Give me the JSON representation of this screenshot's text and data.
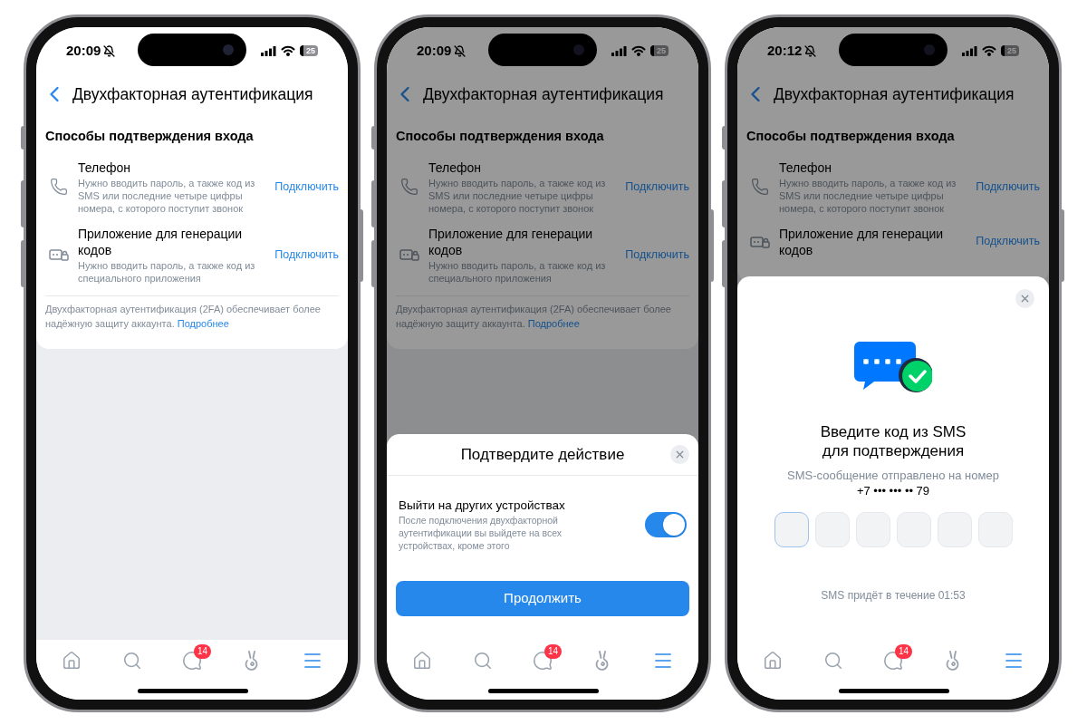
{
  "phones": [
    {
      "status": {
        "time": "20:09",
        "battery": "25"
      },
      "header": {
        "title": "Двухфакторная аутентификация"
      },
      "section_title": "Способы подтверждения входа",
      "methods": [
        {
          "kind": "phone",
          "title": "Телефон",
          "description": "Нужно вводить пароль, а также код из SMS или последние четыре цифры номера, с которого поступит звонок",
          "action": "Подключить"
        },
        {
          "kind": "app",
          "title": "Приложение для генерации кодов",
          "description": "Нужно вводить пароль, а также код из специального приложения",
          "action": "Подключить"
        }
      ],
      "footnote": {
        "text": "Двухфакторная аутентификация (2FA) обеспечивает более надёжную защиту аккаунта.",
        "link": "Подробнее"
      },
      "tabs": [
        {
          "kind": "home",
          "selected": false
        },
        {
          "kind": "search",
          "selected": false
        },
        {
          "kind": "messages",
          "selected": false,
          "badge": "14"
        },
        {
          "kind": "clips",
          "selected": false
        },
        {
          "kind": "menu",
          "selected": true
        }
      ]
    },
    {
      "status": {
        "time": "20:09",
        "battery": "25"
      },
      "header": {
        "title": "Двухфакторная аутентификация"
      },
      "section_title": "Способы подтверждения входа",
      "methods": [
        {
          "kind": "phone",
          "title": "Телефон",
          "description": "Нужно вводить пароль, а также код из SMS или последние четыре цифры номера, с которого поступит звонок",
          "action": "Подключить"
        },
        {
          "kind": "app",
          "title": "Приложение для генерации кодов",
          "description": "Нужно вводить пароль, а также код из специального приложения",
          "action": "Подключить"
        }
      ],
      "footnote": {
        "text": "Двухфакторная аутентификация (2FA) обеспечивает более надёжную защиту аккаунта.",
        "link": "Подробнее"
      },
      "tabs": [
        {
          "kind": "home",
          "selected": false
        },
        {
          "kind": "search",
          "selected": false
        },
        {
          "kind": "messages",
          "selected": false,
          "badge": "14"
        },
        {
          "kind": "clips",
          "selected": false
        },
        {
          "kind": "menu",
          "selected": true
        }
      ],
      "sheet": {
        "kind": "confirm",
        "title": "Подтвердите действие",
        "option": {
          "title": "Выйти на других устройствах",
          "description": "После подключения двухфакторной аутентификации вы выйдете на всех устройствах, кроме этого",
          "on": true
        },
        "button": "Продолжить"
      }
    },
    {
      "status": {
        "time": "20:12",
        "battery": "25"
      },
      "header": {
        "title": "Двухфакторная аутентификация"
      },
      "section_title": "Способы подтверждения входа",
      "methods": [
        {
          "kind": "phone",
          "title": "Телефон",
          "description": "Нужно вводить пароль, а также код из SMS или последние четыре цифры номера, с которого поступит звонок",
          "action": "Подключить"
        },
        {
          "kind": "app",
          "title": "Приложение для генерации кодов",
          "action": "Подключить"
        }
      ],
      "tabs": [
        {
          "kind": "home",
          "selected": false
        },
        {
          "kind": "search",
          "selected": false
        },
        {
          "kind": "messages",
          "selected": false,
          "badge": "14"
        },
        {
          "kind": "clips",
          "selected": false
        },
        {
          "kind": "menu",
          "selected": true
        }
      ],
      "sheet": {
        "kind": "sms",
        "title_lines": [
          "Введите код из SMS",
          "для подтверждения"
        ],
        "subtitle": "SMS-сообщение отправлено на номер",
        "phone": "+7 ••• ••• •• 79",
        "code_cells": [
          {
            "selected": true
          },
          {
            "selected": false
          },
          {
            "selected": false
          },
          {
            "selected": false
          },
          {
            "selected": false
          },
          {
            "selected": false
          }
        ],
        "timer": "SMS придёт в течение 01:53"
      }
    }
  ]
}
